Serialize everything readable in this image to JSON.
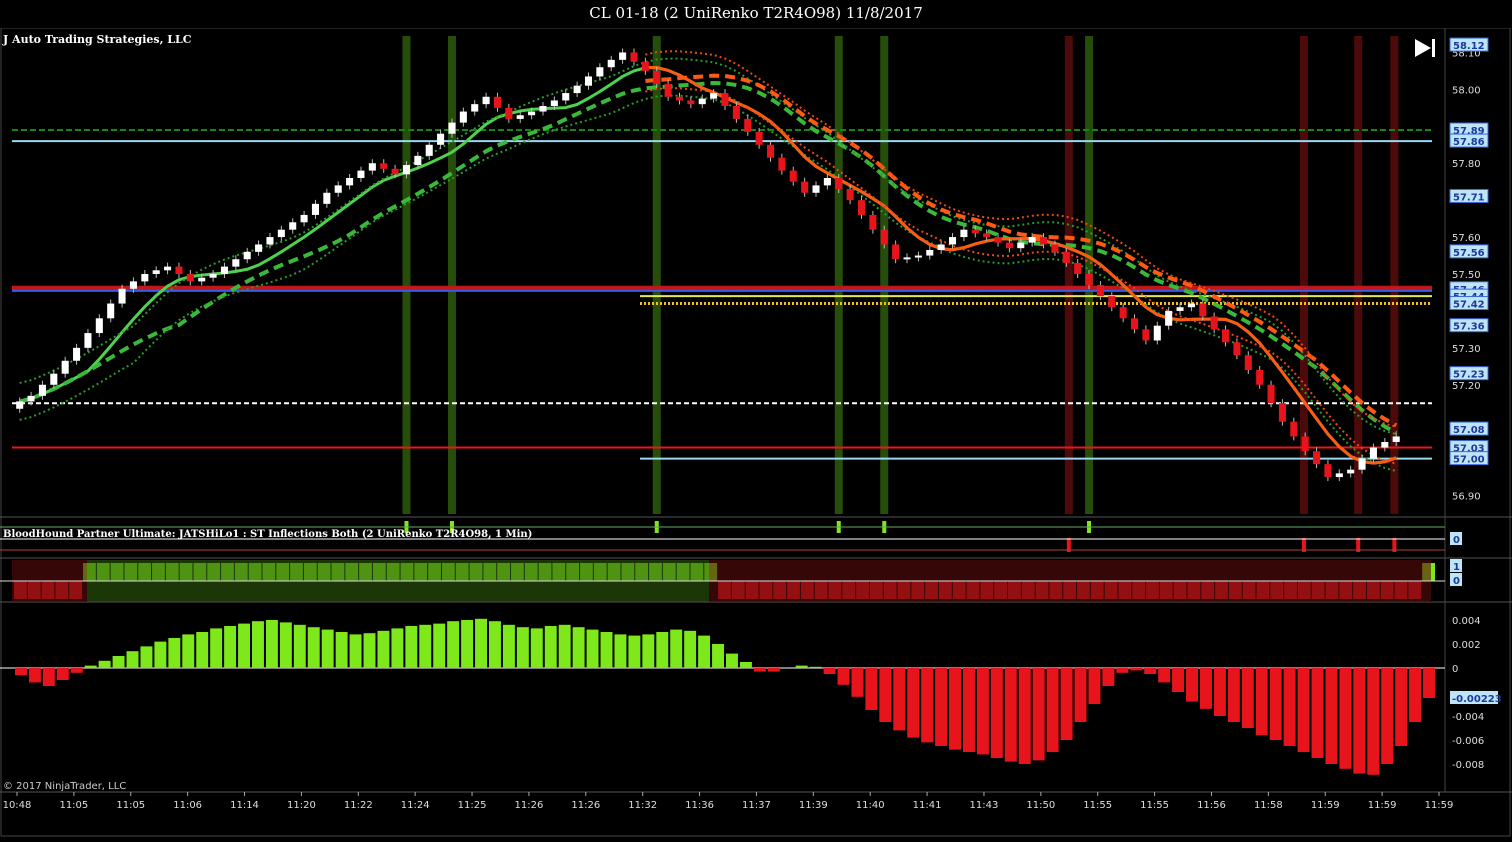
{
  "window": {
    "title": "CL 01-18 (2 UniRenko T2R4O98)  11/8/2017"
  },
  "branding": {
    "company": "J Auto Trading Strategies, LLC",
    "copyright": "© 2017 NinjaTrader, LLC"
  },
  "toolbar": {
    "scroll_end_icon": "skip-to-end-icon"
  },
  "indicator_label": "BloodHound Partner Ultimate: JATSHiLo1 : ST Inflections Both (2 UniRenko T2R4O98, 1 Min)",
  "colors": {
    "bull": "#ffffff",
    "bear": "#e8141c",
    "bull_signal": "#7fe81a",
    "bear_signal": "#c4101a",
    "green_band": "#2d5a0c",
    "red_band": "#5a0c0c",
    "orange": "#ff5a14",
    "grid_green": "#0e8a0e",
    "light_blue": "#9ad8f0"
  },
  "chart_data": [
    {
      "type": "candlestick",
      "title": "CL 01-18 (2 UniRenko T2R4O98)  11/8/2017",
      "ylim": [
        56.85,
        58.15
      ],
      "y_ticks": [
        56.9,
        57.2,
        57.3,
        57.5,
        57.6,
        57.8,
        58.0,
        58.1
      ],
      "price_markers": [
        "58.12",
        "57.89",
        "57.86",
        "57.71",
        "57.56",
        "57.46",
        "57.44",
        "57.42",
        "57.36",
        "57.23",
        "57.08",
        "57.03",
        "57.00"
      ],
      "horizontal_levels": [
        {
          "price": 57.89,
          "style": "dashed-green"
        },
        {
          "price": 57.86,
          "style": "light-blue"
        },
        {
          "price": 57.46,
          "style": "red/blue-band"
        },
        {
          "price": 57.44,
          "style": "yellow"
        },
        {
          "price": 57.42,
          "style": "yellow-dotted"
        },
        {
          "price": 57.15,
          "style": "white-dashed"
        },
        {
          "price": 57.03,
          "style": "red"
        },
        {
          "price": 57.0,
          "style": "light-blue"
        }
      ],
      "x_labels": [
        "10:48",
        "11:05",
        "11:05",
        "11:06",
        "11:14",
        "11:20",
        "11:22",
        "11:24",
        "11:25",
        "11:26",
        "11:26",
        "11:32",
        "11:36",
        "11:37",
        "11:39",
        "11:40",
        "11:41",
        "11:43",
        "11:50",
        "11:55",
        "11:55",
        "11:56",
        "11:58",
        "11:59",
        "11:59",
        "11:59"
      ],
      "price_path": [
        57.14,
        57.17,
        57.23,
        57.3,
        57.38,
        57.46,
        57.5,
        57.52,
        57.48,
        57.5,
        57.54,
        57.58,
        57.62,
        57.66,
        57.72,
        57.76,
        57.8,
        57.77,
        57.82,
        57.88,
        57.94,
        57.98,
        57.92,
        57.94,
        57.97,
        58.01,
        58.06,
        58.1,
        58.05,
        57.98,
        57.96,
        57.99,
        57.92,
        57.85,
        57.78,
        57.72,
        57.76,
        57.7,
        57.62,
        57.54,
        57.55,
        57.58,
        57.62,
        57.6,
        57.57,
        57.6,
        57.56,
        57.5,
        57.44,
        57.38,
        57.32,
        57.4,
        57.42,
        57.35,
        57.28,
        57.2,
        57.1,
        57.02,
        56.95,
        56.97,
        57.03,
        57.06
      ],
      "signals": {
        "buy_bars": [
          17,
          19,
          28,
          36,
          38,
          47
        ],
        "sell_bars": [
          58,
          71,
          74,
          76,
          86
        ]
      }
    },
    {
      "type": "bar",
      "title": "BloodHound Partner Ultimate: JATSHiLo1 : ST Inflections Both (2 UniRenko T2R4O98, 1 Min)",
      "y_ticks": [
        "0"
      ],
      "signals": "inflection markers"
    },
    {
      "type": "bar",
      "title": "trend state",
      "y_ticks": [
        "1",
        "0"
      ],
      "series": [
        {
          "values": "red 0-4, green 5-50, red 51-101, green 102"
        }
      ]
    },
    {
      "type": "bar",
      "title": "histogram",
      "ylim": [
        -0.009,
        0.005
      ],
      "y_ticks": [
        0.004,
        0.002,
        0,
        -0.004,
        -0.006,
        -0.008
      ],
      "y_tick_labels": [
        "0.004",
        "0.002",
        "0",
        "-0.004",
        "-0.006",
        "-0.008"
      ],
      "last_value_label": "-0.00223",
      "values": [
        -0.0006,
        -0.0012,
        -0.0015,
        -0.001,
        -0.0004,
        0.0002,
        0.0006,
        0.001,
        0.0014,
        0.0018,
        0.0022,
        0.0025,
        0.0028,
        0.003,
        0.0033,
        0.0035,
        0.0037,
        0.0039,
        0.004,
        0.0038,
        0.0036,
        0.0034,
        0.0032,
        0.003,
        0.0028,
        0.0029,
        0.0031,
        0.0033,
        0.0035,
        0.0036,
        0.0037,
        0.0039,
        0.004,
        0.0041,
        0.0039,
        0.0036,
        0.0034,
        0.0033,
        0.0035,
        0.0036,
        0.0034,
        0.0032,
        0.003,
        0.0028,
        0.0027,
        0.0028,
        0.003,
        0.0032,
        0.0031,
        0.0027,
        0.002,
        0.0012,
        0.0005,
        -0.0003,
        -0.0003,
        0.0,
        0.0002,
        0.0001,
        -0.0005,
        -0.0014,
        -0.0024,
        -0.0035,
        -0.0045,
        -0.0052,
        -0.0058,
        -0.0062,
        -0.0065,
        -0.0068,
        -0.007,
        -0.0072,
        -0.0075,
        -0.0078,
        -0.008,
        -0.0077,
        -0.007,
        -0.006,
        -0.0045,
        -0.003,
        -0.0015,
        -0.0004,
        -0.0002,
        -0.0005,
        -0.0012,
        -0.002,
        -0.0028,
        -0.0034,
        -0.004,
        -0.0045,
        -0.005,
        -0.0056,
        -0.006,
        -0.0065,
        -0.007,
        -0.0075,
        -0.008,
        -0.0084,
        -0.0088,
        -0.0089,
        -0.008,
        -0.0065,
        -0.0045,
        -0.0025
      ]
    }
  ]
}
